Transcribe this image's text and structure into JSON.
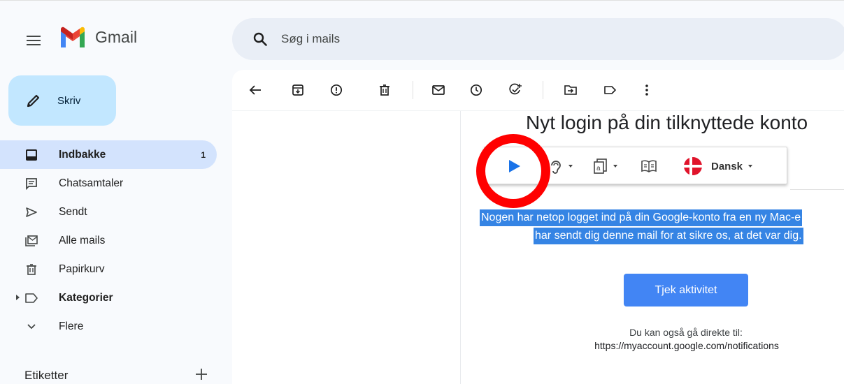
{
  "app": {
    "name": "Gmail"
  },
  "search": {
    "placeholder": "Søg i mails"
  },
  "compose": {
    "label": "Skriv"
  },
  "nav": {
    "items": [
      {
        "label": "Indbakke",
        "count": "1",
        "icon": "inbox-icon",
        "active": true,
        "bold": true
      },
      {
        "label": "Chatsamtaler",
        "icon": "chat-icon"
      },
      {
        "label": "Sendt",
        "icon": "send-icon"
      },
      {
        "label": "Alle mails",
        "icon": "all-mail-icon"
      },
      {
        "label": "Papirkurv",
        "icon": "trash-icon"
      },
      {
        "label": "Kategorier",
        "icon": "label-icon",
        "bold": true,
        "expandable": true
      },
      {
        "label": "Flere",
        "icon": "chevron-down-icon"
      }
    ],
    "labels_heading": "Etiketter"
  },
  "toolbar": {
    "icons": [
      "back-arrow-icon",
      "archive-icon",
      "report-spam-icon",
      "delete-icon",
      "mark-unread-icon",
      "snooze-icon",
      "add-task-icon",
      "move-to-icon",
      "label-icon",
      "more-vert-icon"
    ]
  },
  "email": {
    "title": "Nyt login på din tilknyttede konto",
    "line1": "Nogen har netop logget ind på din Google-konto fra en ny Mac-e",
    "line2": "har sendt dig denne mail for at sikre os, at det var dig.",
    "button_label": "Tjek aktivitet",
    "direct_text": "Du kan også gå direkte til:",
    "direct_link": "https://myaccount.google.com/notifications"
  },
  "read_aloud": {
    "language": "Dansk",
    "icons": [
      "play-icon",
      "voice-icon",
      "reading-mode-icon",
      "dictionary-icon",
      "denmark-flag-icon"
    ]
  },
  "colors": {
    "accent": "#c2e7ff",
    "nav_active": "#d3e3fd",
    "search_bg": "#e9eef6",
    "button": "#4285f4",
    "selection": "#3584e4",
    "highlight_ring": "#ff0000"
  }
}
